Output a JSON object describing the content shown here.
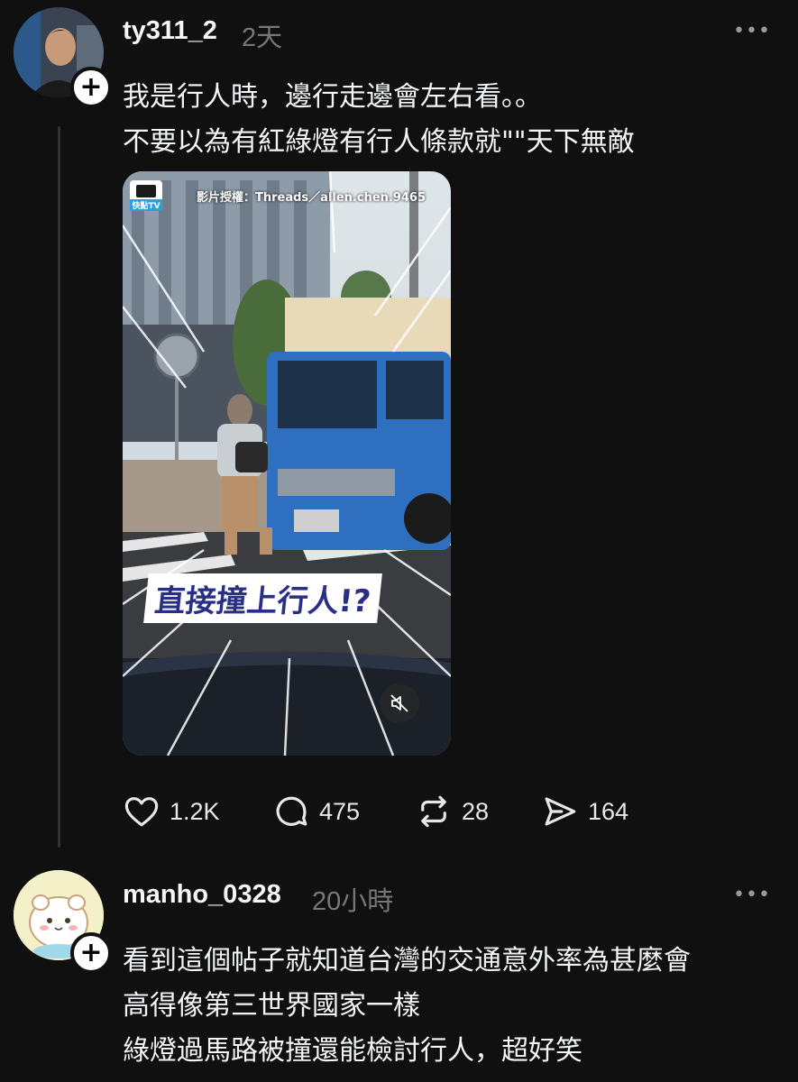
{
  "post": {
    "username": "ty311_2",
    "time": "2天",
    "more": "•••",
    "lines": [
      "我是行人時，邊行走邊會左右看。。",
      "不要以為有紅綠燈有行人條款就\"\"天下無敵"
    ],
    "video": {
      "logo": "快點TV",
      "credit": "影片授權：Threads／allen.chen.9465",
      "caption": "直接撞上行人!?"
    },
    "actions": {
      "likes": "1.2K",
      "comments": "475",
      "reposts": "28",
      "shares": "164"
    }
  },
  "reply": {
    "username": "manho_0328",
    "time": "20小時",
    "more": "•••",
    "lines": [
      "看到這個帖子就知道台灣的交通意外率為甚麼會",
      "高得像第三世界國家一樣",
      "綠燈過馬路被撞還能檢討行人，超好笑"
    ]
  },
  "colors": {
    "background": "#101010",
    "text": "#f3f5f7",
    "muted": "#777777",
    "truck": "#2f6fc0"
  }
}
